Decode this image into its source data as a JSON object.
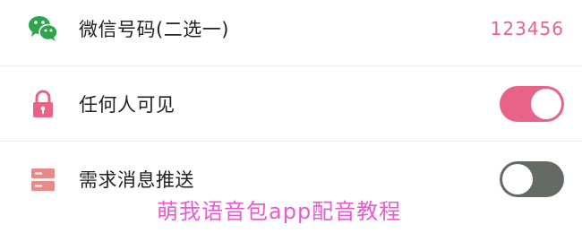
{
  "rows": [
    {
      "label": "微信号码(二选一)",
      "value": "123456",
      "icon": "wechat-icon"
    },
    {
      "label": "任何人可见",
      "toggle": "on",
      "icon": "lock-icon"
    },
    {
      "label": "需求消息推送",
      "toggle": "off",
      "icon": "server-icon"
    }
  ],
  "watermark": "萌我语音包app配音教程",
  "colors": {
    "accent": "#e8638a",
    "wechat": "#2ea44f",
    "toggle_off": "#666a66",
    "value_text": "#e8638a",
    "watermark_text": "#e85bd0"
  }
}
